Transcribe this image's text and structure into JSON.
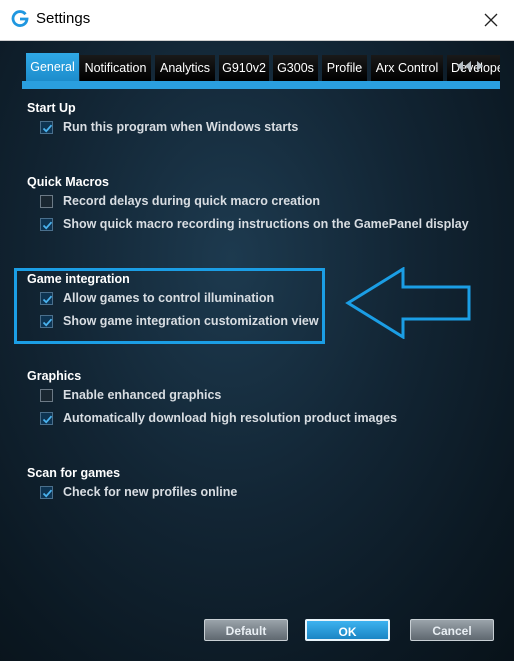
{
  "window": {
    "title": "Settings",
    "icon": "logitech-g-icon",
    "close_icon": "close-icon"
  },
  "tabs": [
    {
      "label": "General",
      "active": true
    },
    {
      "label": "Notification",
      "active": false
    },
    {
      "label": "Analytics",
      "active": false
    },
    {
      "label": "G910v2",
      "active": false
    },
    {
      "label": "G300s",
      "active": false
    },
    {
      "label": "Profile",
      "active": false
    },
    {
      "label": "Arx Control",
      "active": false
    },
    {
      "label": "Developer",
      "active": false
    }
  ],
  "sections": [
    {
      "title": "Start Up",
      "options": [
        {
          "label": "Run this program when Windows starts",
          "checked": true
        }
      ]
    },
    {
      "title": "Quick Macros",
      "options": [
        {
          "label": "Record delays during quick macro creation",
          "checked": false
        },
        {
          "label": "Show quick macro recording instructions on the GamePanel display",
          "checked": true
        }
      ]
    },
    {
      "title": "Game integration",
      "options": [
        {
          "label": "Allow games to control illumination",
          "checked": true
        },
        {
          "label": "Show game integration customization view",
          "checked": true
        }
      ]
    },
    {
      "title": "Graphics",
      "options": [
        {
          "label": "Enable enhanced graphics",
          "checked": false
        },
        {
          "label": "Automatically download high resolution product images",
          "checked": true
        }
      ]
    },
    {
      "title": "Scan for games",
      "options": [
        {
          "label": "Check for new profiles online",
          "checked": true
        }
      ]
    }
  ],
  "buttons": {
    "default": "Default",
    "ok": "OK",
    "cancel": "Cancel"
  },
  "colors": {
    "accent": "#2a9fdf",
    "highlight": "#1b9ee5"
  }
}
